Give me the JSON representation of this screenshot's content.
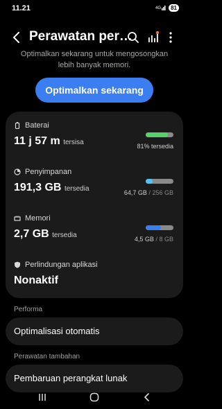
{
  "status": {
    "time": "11.21",
    "signal": "4G",
    "battery": "81"
  },
  "appbar": {
    "title": "Perawatan per…",
    "icons": [
      "back-icon",
      "search-icon",
      "signal-stats-icon",
      "more-vertical-icon"
    ]
  },
  "intro": {
    "text": "Optimalkan sekarang untuk mengosongkan lebih banyak memori."
  },
  "optimize_button": {
    "label": "Optimalkan sekarang"
  },
  "items": {
    "battery": {
      "label": "Baterai",
      "value_h": "11",
      "unit_h": "j",
      "value_m": "57",
      "unit_m": "m",
      "suffix": "tersisa",
      "detail": "81% tersedia",
      "fill": 0.81,
      "color": "#57d26a"
    },
    "storage": {
      "label": "Penyimpanan",
      "value": "191,3 GB",
      "suffix": "tersedia",
      "used": "64,7 GB",
      "sep": "/",
      "total": "256 GB",
      "fill": 0.25,
      "color": "#4fc3f7"
    },
    "memory": {
      "label": "Memori",
      "value": "2,7 GB",
      "suffix": "tersedia",
      "used": "4,5 GB",
      "sep": "/",
      "total": "8 GB",
      "fill": 0.56,
      "color": "#3b7ef2"
    },
    "protection": {
      "label": "Perlindungan aplikasi",
      "value": "Nonaktif"
    }
  },
  "sections": {
    "performance": {
      "title": "Performa",
      "item": "Optimalisasi otomatis"
    },
    "extra": {
      "title": "Perawatan tambahan",
      "item": "Pembaruan perangkat lunak"
    }
  },
  "navbar": {
    "icons": [
      "recents-icon",
      "home-icon",
      "back-nav-icon"
    ]
  }
}
